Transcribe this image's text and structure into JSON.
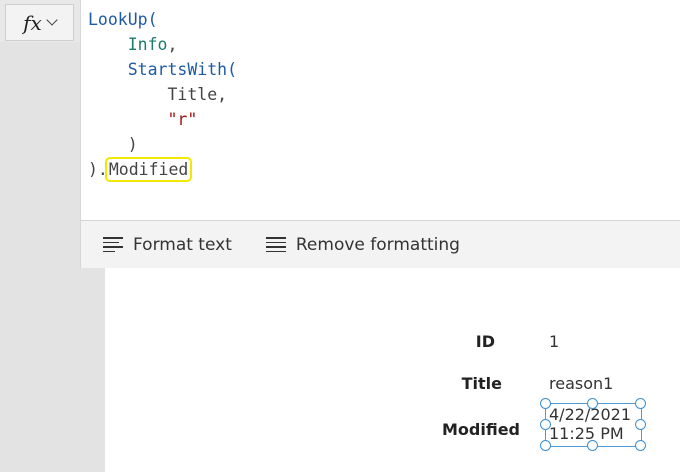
{
  "formula_bar": {
    "fx_label": "fx",
    "code_lines": [
      {
        "parts": [
          {
            "t": "LookUp(",
            "c": "fn"
          }
        ]
      },
      {
        "parts": [
          {
            "t": "    ",
            "c": "plain"
          },
          {
            "t": "Info",
            "c": "ident"
          },
          {
            "t": ",",
            "c": "plain"
          }
        ]
      },
      {
        "parts": [
          {
            "t": "    ",
            "c": "plain"
          },
          {
            "t": "StartsWith(",
            "c": "fn"
          }
        ]
      },
      {
        "parts": [
          {
            "t": "        Title,",
            "c": "plain"
          }
        ]
      },
      {
        "parts": [
          {
            "t": "        ",
            "c": "plain"
          },
          {
            "t": "\"r\"",
            "c": "str"
          }
        ]
      },
      {
        "parts": [
          {
            "t": "    )",
            "c": "plain"
          }
        ]
      },
      {
        "parts": [
          {
            "t": ").",
            "c": "plain"
          },
          {
            "t": "Modified",
            "c": "plain",
            "highlight": true
          }
        ]
      }
    ]
  },
  "toolbar": {
    "format_text_label": "Format text",
    "remove_formatting_label": "Remove formatting"
  },
  "form": {
    "fields": [
      {
        "label": "ID",
        "value": "1"
      },
      {
        "label": "Title",
        "value": "reason1"
      },
      {
        "label": "Modified",
        "value_line1": "4/22/2021",
        "value_line2": "11:25 PM"
      }
    ]
  },
  "colors": {
    "highlight": "#f2e800",
    "selection": "#3d8fd1",
    "function": "#1f5aa6",
    "identifier": "#1c7a6e",
    "string": "#a31515"
  }
}
